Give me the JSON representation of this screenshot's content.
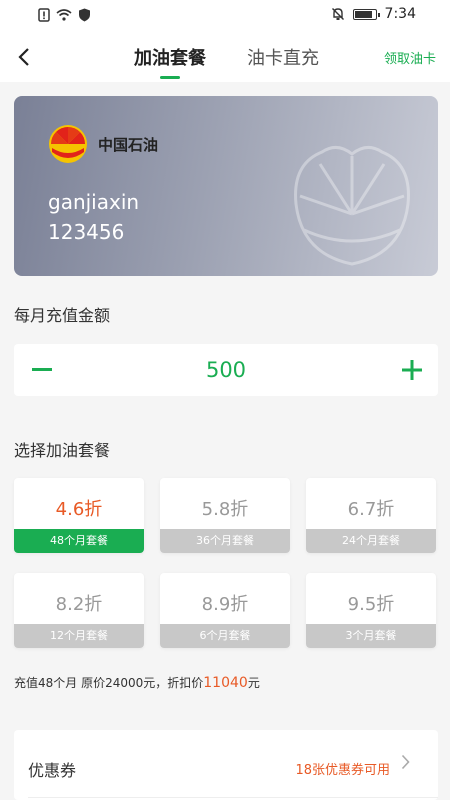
{
  "status_bar": {
    "time": "7:34"
  },
  "nav": {
    "tabs": [
      {
        "label": "加油套餐"
      },
      {
        "label": "油卡直充"
      }
    ],
    "right_action": "领取油卡"
  },
  "card": {
    "brand": "中国石油",
    "username": "ganjiaxin",
    "card_number": "123456"
  },
  "monthly": {
    "title": "每月充值金额",
    "amount": "500"
  },
  "packages": {
    "title": "选择加油套餐",
    "items": [
      {
        "discount": "4.6折",
        "label": "48个月套餐",
        "selected": true
      },
      {
        "discount": "5.8折",
        "label": "36个月套餐",
        "selected": false
      },
      {
        "discount": "6.7折",
        "label": "24个月套餐",
        "selected": false
      },
      {
        "discount": "8.2折",
        "label": "12个月套餐",
        "selected": false
      },
      {
        "discount": "8.9折",
        "label": "6个月套餐",
        "selected": false
      },
      {
        "discount": "9.5折",
        "label": "3个月套餐",
        "selected": false
      }
    ]
  },
  "summary": {
    "prefix": "充值48个月 原价24000元，折扣价",
    "price": "11040",
    "suffix": "元"
  },
  "coupon": {
    "label": "优惠券",
    "value": "18张优惠券可用"
  },
  "colors": {
    "accent": "#1aad52",
    "price": "#e85a26",
    "card_gradient_start": "#7a8096",
    "card_gradient_end": "#c8cbd6"
  }
}
